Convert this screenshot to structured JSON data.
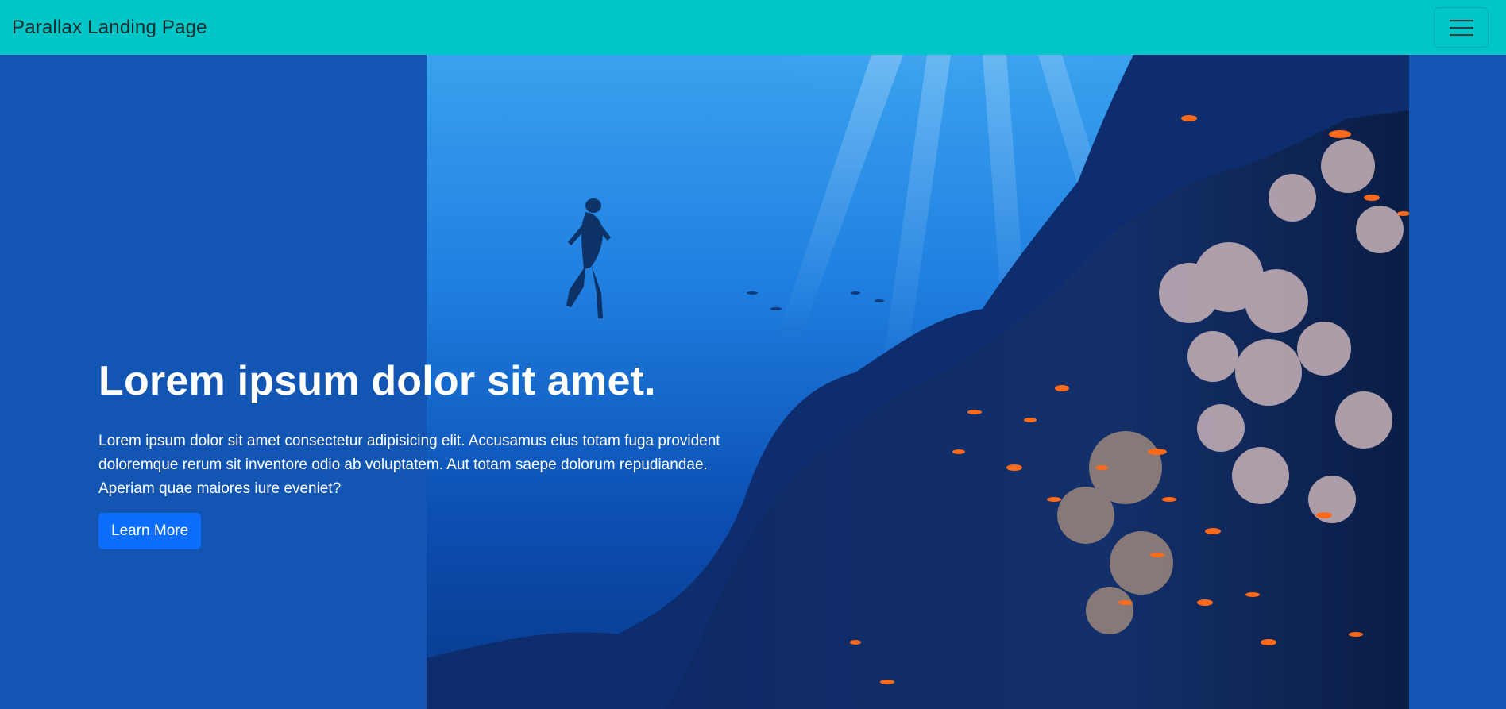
{
  "navbar": {
    "brand": "Parallax Landing Page",
    "toggle_icon": "hamburger-menu-icon",
    "background": "#00c6c8"
  },
  "hero": {
    "headline": "Lorem ipsum dolor sit amet.",
    "body": "Lorem ipsum dolor sit amet consectetur adipisicing elit. Accusamus eius totam fuga provident doloremque rerum sit inventore odio ab voluptatem. Aut totam saepe dolorum repudiandae. Aperiam quae maiores iure eveniet?",
    "cta_label": "Learn More",
    "background": "#1255b3",
    "cta_color": "#0d6efd"
  }
}
